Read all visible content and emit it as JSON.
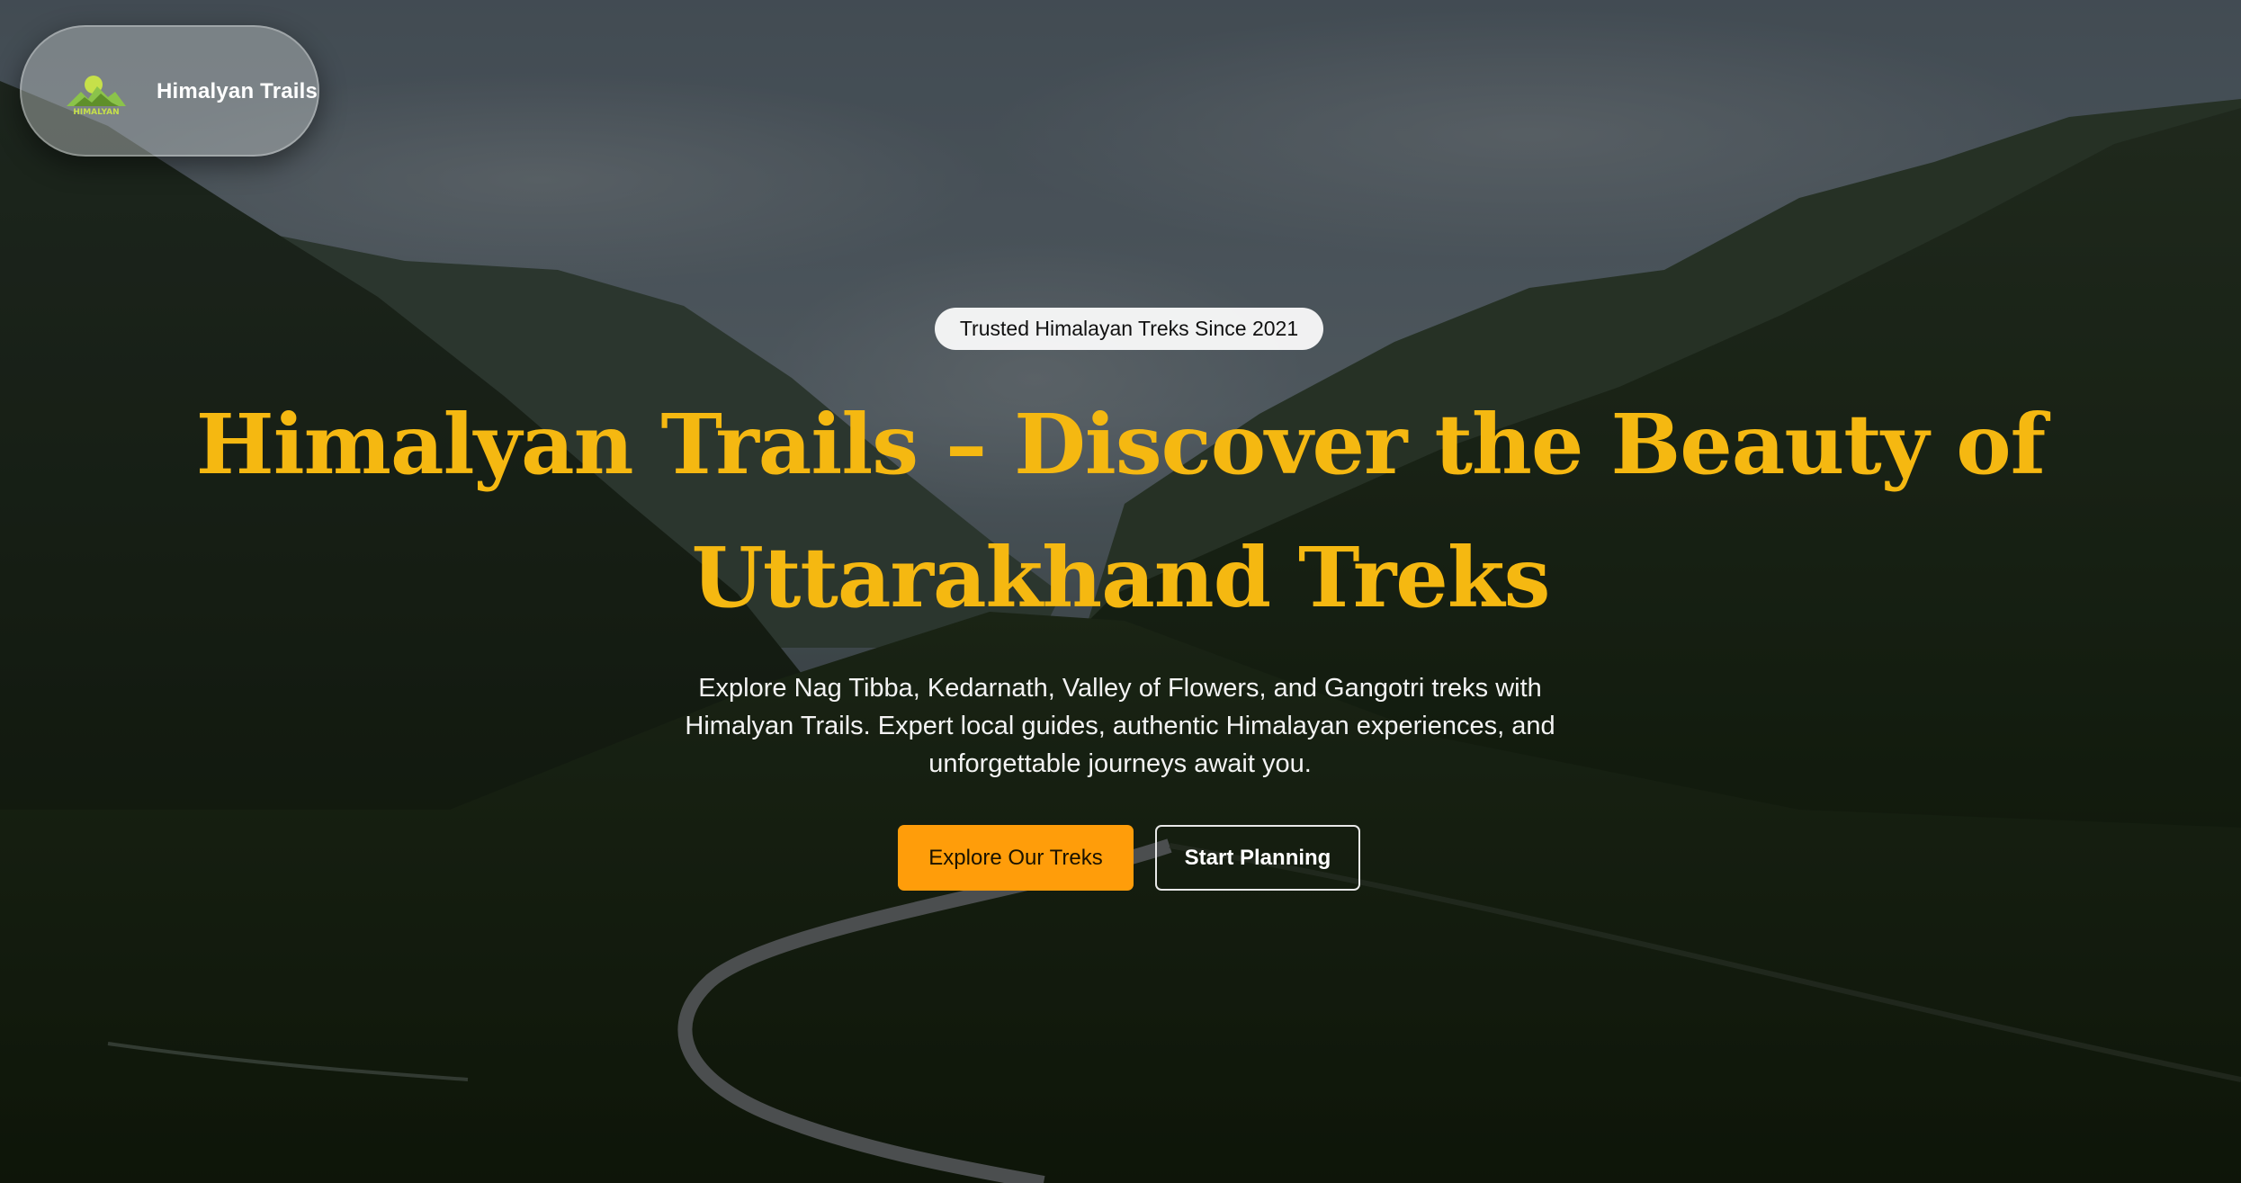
{
  "nav": {
    "brand_name": "Himalyan Trails",
    "logo_text": "HIMALYAN",
    "logo_colors": {
      "mountain": "#8bc34a",
      "sun": "#c6e04a"
    }
  },
  "hero": {
    "badge": "Trusted Himalayan Treks Since 2021",
    "headline": "Himalyan Trails – Discover the Beauty of Uttarakhand Treks",
    "subtext": "Explore Nag Tibba, Kedarnath, Valley of Flowers, and Gangotri treks with Himalyan Trails. Expert local guides, authentic Himalayan experiences, and unforgettable journeys await you.",
    "primary_button": "Explore Our Treks",
    "secondary_button": "Start Planning",
    "background_image": "mountain-valley-road"
  },
  "colors": {
    "accent": "#f5b811",
    "primary_button": "#ff9d0a",
    "badge_bg": "#ffffff"
  }
}
